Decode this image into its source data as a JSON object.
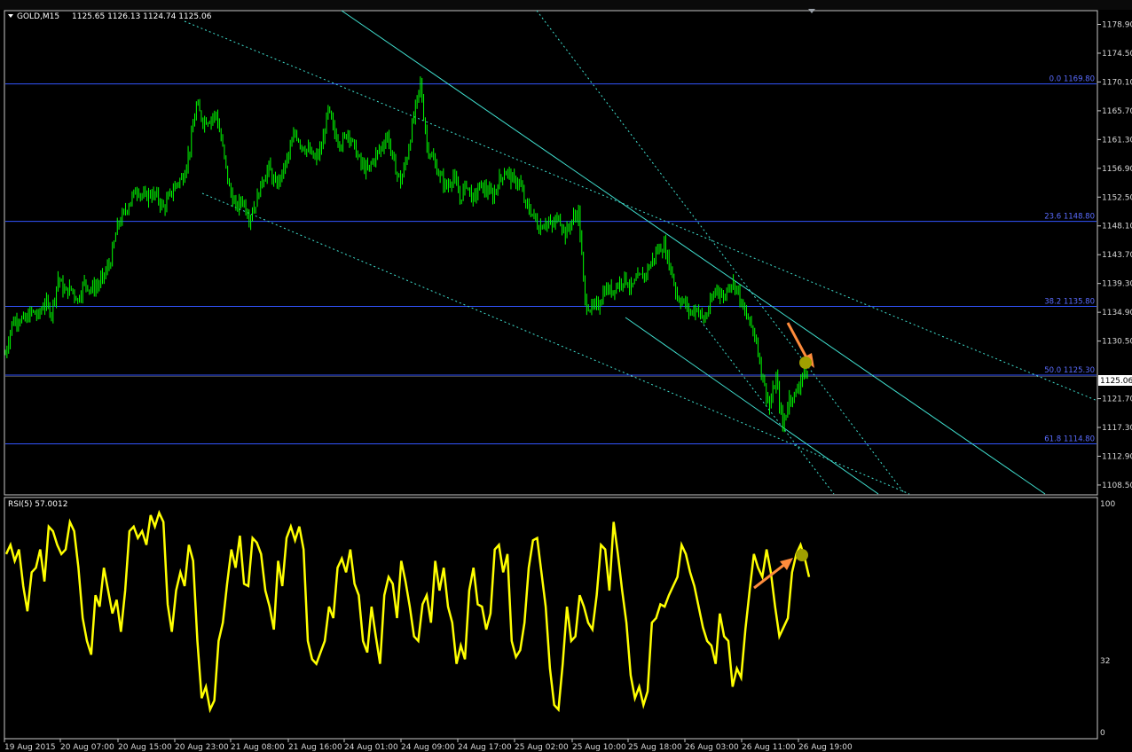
{
  "header": {
    "symbol": "GOLD,M15",
    "ohlc": "1125.65 1126.13 1124.74 1125.06"
  },
  "rsi": {
    "label": "RSI(5) 57.0012",
    "levels": [
      "100",
      "32",
      "0"
    ]
  },
  "colors": {
    "background": "#000000",
    "frame": "#c8c8c8",
    "candles": "#00ff00",
    "rsi_line": "#ffff00",
    "fib_lines": "#3355ff",
    "trend_lines": "#40e0d0",
    "arrow": "#ff8c3c",
    "marker": "#a0a000"
  },
  "chart_data": [
    {
      "type": "line",
      "series": [
        {
          "values": [
            1128.5,
            1133.2,
            1134.0,
            1133.6,
            1135.0,
            1134.3,
            1136.5,
            1134.8,
            1140.2,
            1138.0,
            1138.5,
            1136.8,
            1139.5,
            1138.4,
            1139.0,
            1140.5,
            1142.8,
            1148.0,
            1150.0,
            1152.0,
            1153.8,
            1152.4,
            1153.0,
            1152.6,
            1150.8,
            1152.8,
            1154.6,
            1155.6,
            1160.0,
            1166.5,
            1164.2,
            1164.4,
            1165.2,
            1160.0,
            1153.8,
            1150.8,
            1152.2,
            1149.4,
            1151.6,
            1155.0,
            1157.0,
            1154.2,
            1156.0,
            1159.0,
            1162.4,
            1160.4,
            1159.6,
            1158.2,
            1160.0,
            1165.8,
            1162.2,
            1160.6,
            1162.6,
            1160.0,
            1157.5,
            1156.5,
            1158.5,
            1160.0,
            1162.0,
            1157.4,
            1154.8,
            1158.8,
            1164.8,
            1169.8,
            1160.4,
            1158.0,
            1155.6,
            1154.0,
            1155.8,
            1152.2,
            1154.6,
            1152.0,
            1154.2,
            1153.6,
            1152.6,
            1155.2,
            1156.6,
            1155.0,
            1154.8,
            1151.2,
            1150.0,
            1147.8,
            1148.8,
            1148.0,
            1149.6,
            1146.8,
            1149.0,
            1150.2,
            1136.4,
            1135.4,
            1136.0,
            1138.4,
            1138.2,
            1139.2,
            1140.2,
            1138.6,
            1140.0,
            1140.6,
            1142.4,
            1144.4,
            1145.0,
            1141.6,
            1137.2,
            1136.4,
            1134.8,
            1135.6,
            1133.6,
            1136.0,
            1138.8,
            1137.0,
            1139.6,
            1138.8,
            1135.2,
            1133.4,
            1130.6,
            1124.6,
            1120.4,
            1124.8,
            1117.4,
            1121.8,
            1122.4,
            1125.6,
            1125.06
          ]
        }
      ],
      "ylim": [
        1107.0,
        1181.0
      ],
      "yticks": [
        "1178.90",
        "1174.50",
        "1170.10",
        "1165.70",
        "1161.30",
        "1156.90",
        "1152.50",
        "1148.10",
        "1143.70",
        "1139.30",
        "1134.90",
        "1130.50",
        "1121.70",
        "1117.30",
        "1112.90",
        "1108.50"
      ],
      "current_price": "1125.06",
      "fib_levels": [
        {
          "label": "0.0",
          "price": 1169.8,
          "text": "1169.80"
        },
        {
          "label": "23.6",
          "price": 1148.8,
          "text": "1148.80"
        },
        {
          "label": "38.2",
          "price": 1135.8,
          "text": "1135.80"
        },
        {
          "label": "50.0",
          "price": 1125.3,
          "text": "1125.30"
        },
        {
          "label": "61.8",
          "price": 1114.8,
          "text": "1114.80"
        }
      ],
      "xticks": [
        "19 Aug 2015",
        "20 Aug 07:00",
        "20 Aug 15:00",
        "20 Aug 23:00",
        "21 Aug 08:00",
        "21 Aug 16:00",
        "24 Aug 01:00",
        "24 Aug 09:00",
        "24 Aug 17:00",
        "25 Aug 02:00",
        "25 Aug 10:00",
        "25 Aug 18:00",
        "26 Aug 03:00",
        "26 Aug 11:00",
        "26 Aug 19:00"
      ]
    },
    {
      "type": "line",
      "series": [
        {
          "values": [
            78,
            82,
            75,
            80,
            64,
            53,
            70,
            72,
            80,
            66,
            90,
            88,
            82,
            78,
            80,
            92,
            88,
            72,
            50,
            40,
            34,
            60,
            55,
            72,
            62,
            52,
            58,
            44,
            62,
            88,
            90,
            85,
            88,
            82,
            95,
            90,
            96,
            92,
            56,
            44,
            62,
            70,
            64,
            82,
            75,
            40,
            15,
            20,
            10,
            14,
            40,
            48,
            65,
            80,
            72,
            86,
            65,
            64,
            85,
            83,
            78,
            62,
            55,
            45,
            75,
            64,
            85,
            90,
            84,
            90,
            80,
            40,
            32,
            30,
            35,
            40,
            55,
            50,
            72,
            76,
            70,
            80,
            65,
            60,
            40,
            35,
            55,
            42,
            30,
            60,
            68,
            65,
            50,
            75,
            66,
            55,
            42,
            40,
            56,
            60,
            48,
            75,
            62,
            72,
            55,
            48,
            30,
            38,
            32,
            62,
            72,
            56,
            55,
            45,
            52,
            80,
            82,
            70,
            78,
            40,
            33,
            36,
            48,
            72,
            84,
            85,
            70,
            55,
            28,
            12,
            10,
            30,
            55,
            40,
            42,
            60,
            55,
            48,
            45,
            60,
            82,
            80,
            62,
            92,
            78,
            62,
            48,
            25,
            15,
            20,
            12,
            18,
            48,
            50,
            56,
            55,
            60,
            64,
            68,
            82,
            78,
            70,
            64,
            55,
            46,
            40,
            38,
            30,
            52,
            42,
            40,
            20,
            28,
            24,
            45,
            62,
            78,
            72,
            68,
            80,
            70,
            55,
            42,
            46,
            50,
            70,
            78,
            82,
            76,
            68
          ]
        }
      ],
      "ylim": [
        0,
        100
      ]
    }
  ]
}
